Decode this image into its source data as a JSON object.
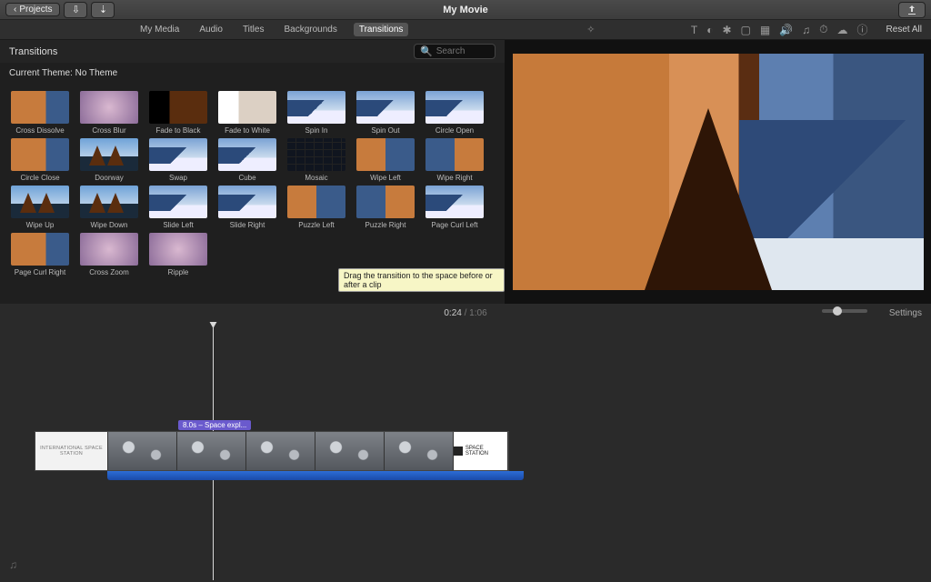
{
  "titlebar": {
    "back_label": "Projects",
    "title": "My Movie"
  },
  "tabs": {
    "my_media": "My Media",
    "audio": "Audio",
    "titles": "Titles",
    "backgrounds": "Backgrounds",
    "transitions": "Transitions"
  },
  "viewer_toolbar": {
    "reset_all": "Reset All"
  },
  "browser": {
    "panel_title": "Transitions",
    "search_placeholder": "Search",
    "theme_label": "Current Theme: No Theme",
    "tooltip": "Drag the transition to the space before or after a clip",
    "items": [
      {
        "label": "Cross Dissolve",
        "style": "t-rock"
      },
      {
        "label": "Cross Blur",
        "style": "t-blur"
      },
      {
        "label": "Fade to Black",
        "style": "t-black"
      },
      {
        "label": "Fade to White",
        "style": "t-white"
      },
      {
        "label": "Spin In",
        "style": "t-mtn"
      },
      {
        "label": "Spin Out",
        "style": "t-mtn"
      },
      {
        "label": "Circle Open",
        "style": "t-mtn"
      },
      {
        "label": "Circle Close",
        "style": "t-rock"
      },
      {
        "label": "Doorway",
        "style": "t-trees"
      },
      {
        "label": "Swap",
        "style": "t-mtn"
      },
      {
        "label": "Cube",
        "style": "t-mtn"
      },
      {
        "label": "Mosaic",
        "style": "t-mosaic"
      },
      {
        "label": "Wipe Left",
        "style": "t-mix1"
      },
      {
        "label": "Wipe Right",
        "style": "t-mix2"
      },
      {
        "label": "Wipe Up",
        "style": "t-trees"
      },
      {
        "label": "Wipe Down",
        "style": "t-trees"
      },
      {
        "label": "Slide Left",
        "style": "t-mtn"
      },
      {
        "label": "Slide Right",
        "style": "t-mtn"
      },
      {
        "label": "Puzzle Left",
        "style": "t-mix1"
      },
      {
        "label": "Puzzle Right",
        "style": "t-mix2"
      },
      {
        "label": "Page Curl Left",
        "style": "t-mtn"
      },
      {
        "label": "Page Curl Right",
        "style": "t-rock"
      },
      {
        "label": "Cross Zoom",
        "style": "t-blur"
      },
      {
        "label": "Ripple",
        "style": "t-blur"
      }
    ]
  },
  "playback": {
    "current": "0:24",
    "total": "1:06",
    "settings_label": "Settings"
  },
  "timeline": {
    "clip_badge": "8.0s – Space expl...",
    "title_card": "International Space Station",
    "end_card": "SPACE STATION"
  }
}
